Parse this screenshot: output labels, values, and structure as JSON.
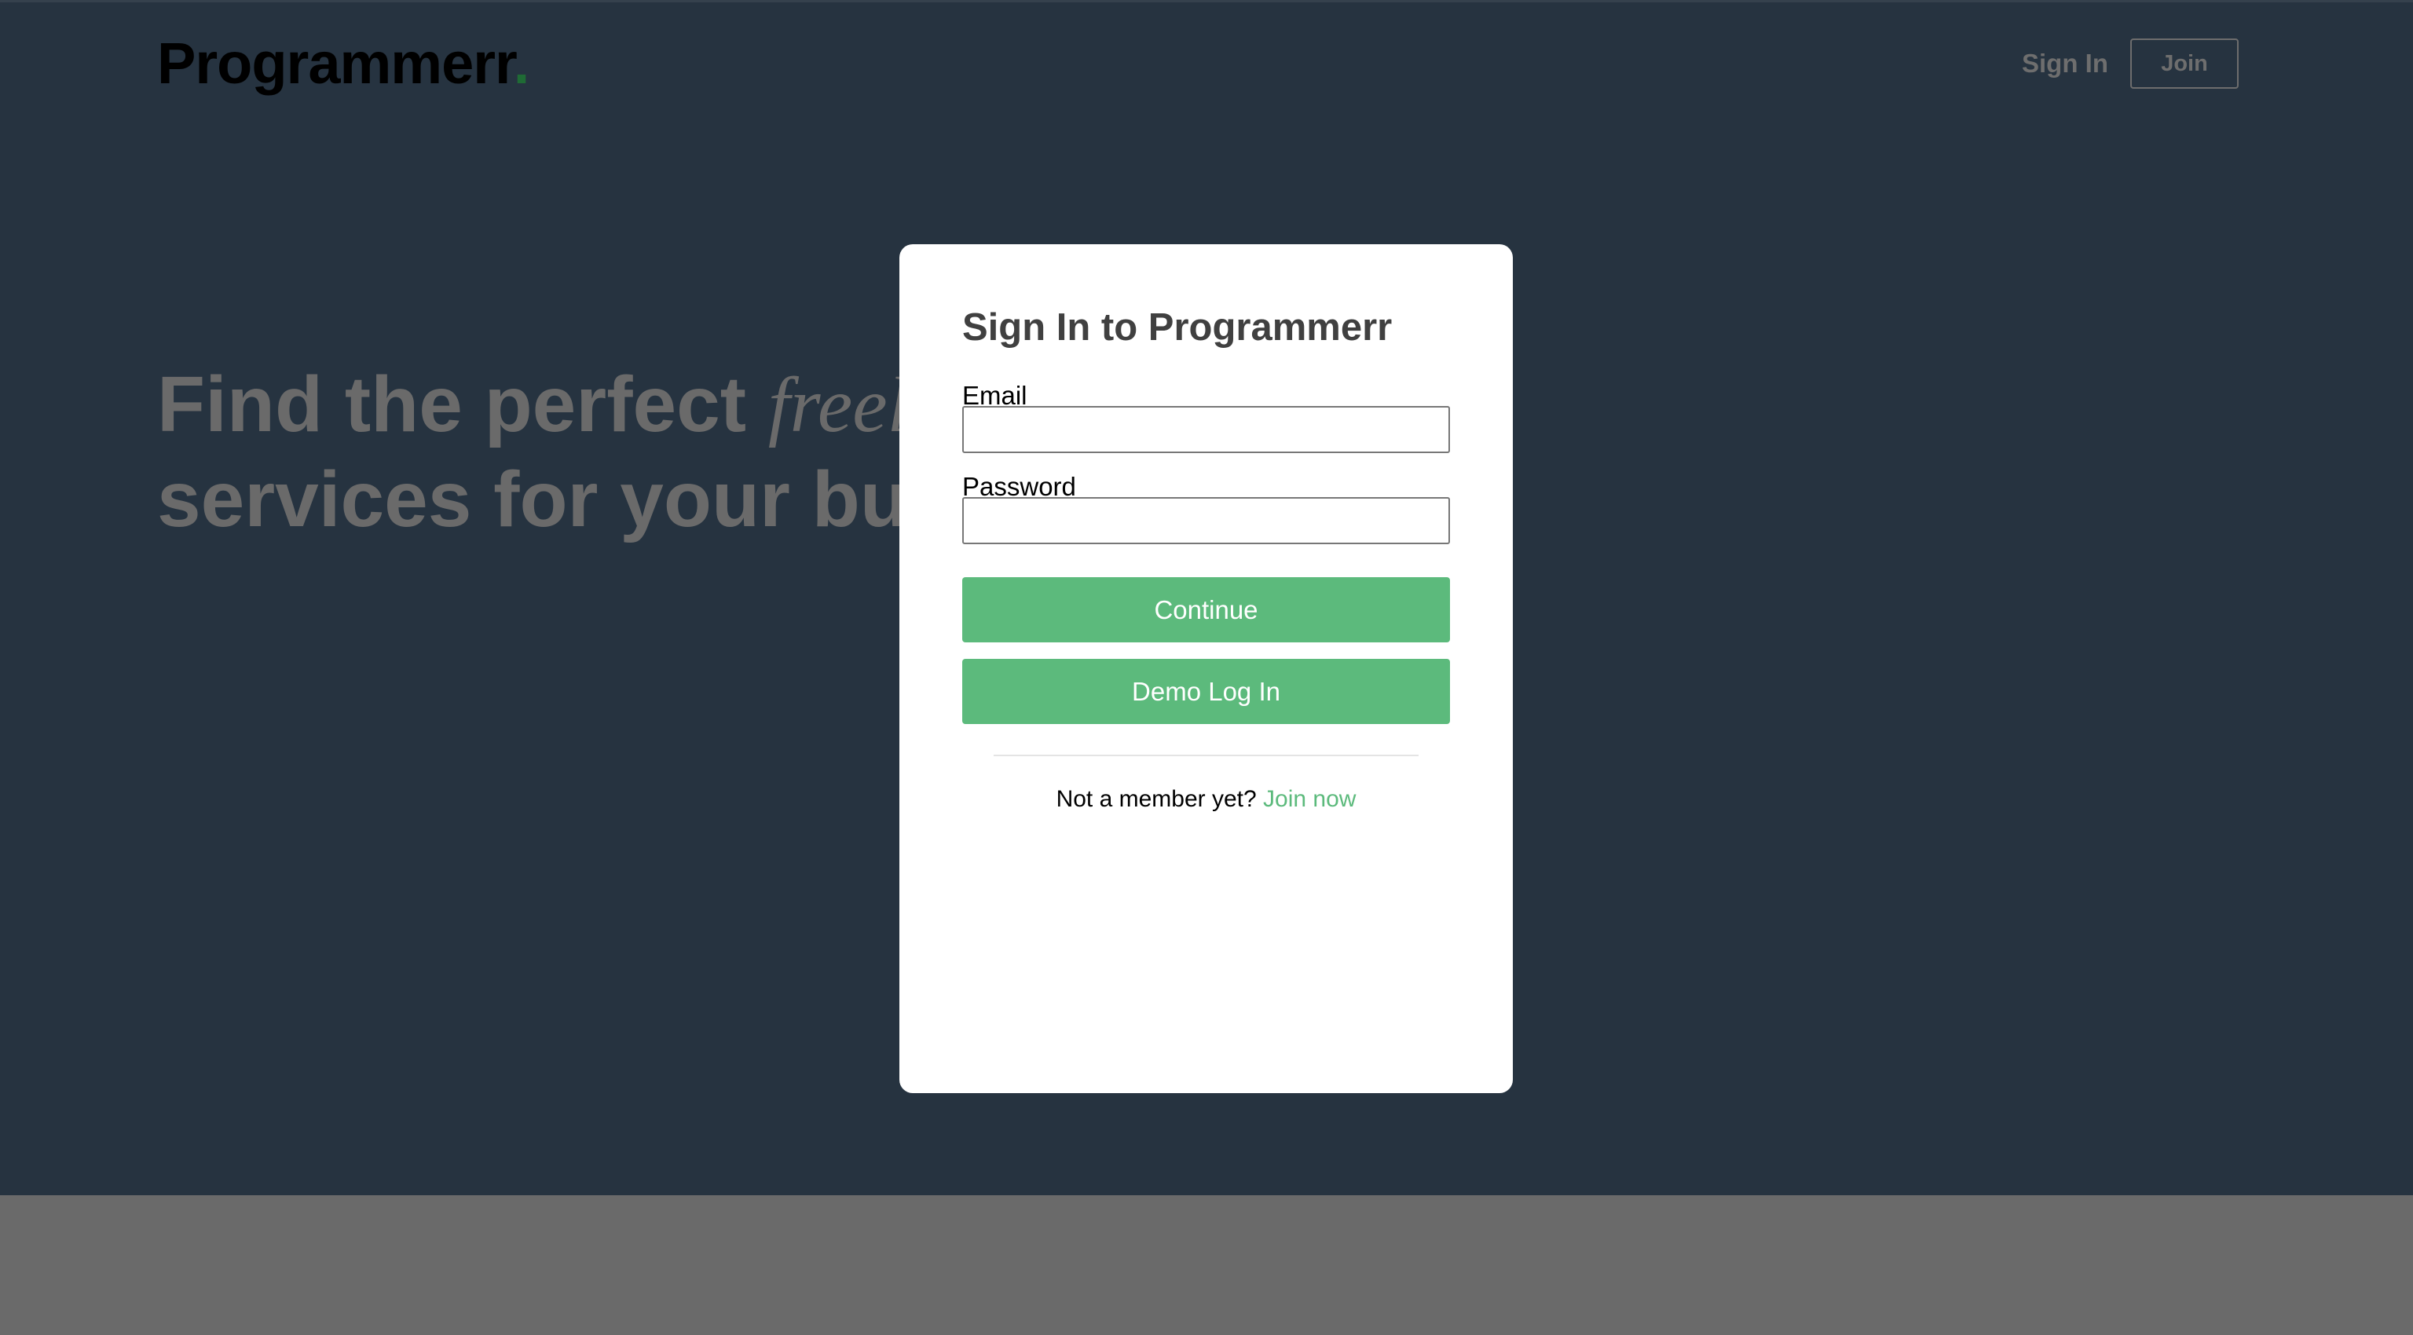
{
  "header": {
    "logo_text": "Programmerr",
    "logo_dot": ".",
    "sign_in_label": "Sign In",
    "join_label": "Join"
  },
  "hero": {
    "headline_prefix": "Find the perfect ",
    "headline_italic": "freela",
    "headline_line2": "services for your bus"
  },
  "modal": {
    "title": "Sign In to Programmerr",
    "email_label": "Email",
    "email_value": "",
    "password_label": "Password",
    "password_value": "",
    "continue_label": "Continue",
    "demo_label": "Demo Log In",
    "join_prompt": "Not a member yet? ",
    "join_link": "Join now"
  },
  "colors": {
    "hero_background": "#263340",
    "bottom_band": "#6a6a6a",
    "accent": "#5cba7c",
    "logo_dot": "#1f6b35",
    "modal_title": "#404040"
  }
}
